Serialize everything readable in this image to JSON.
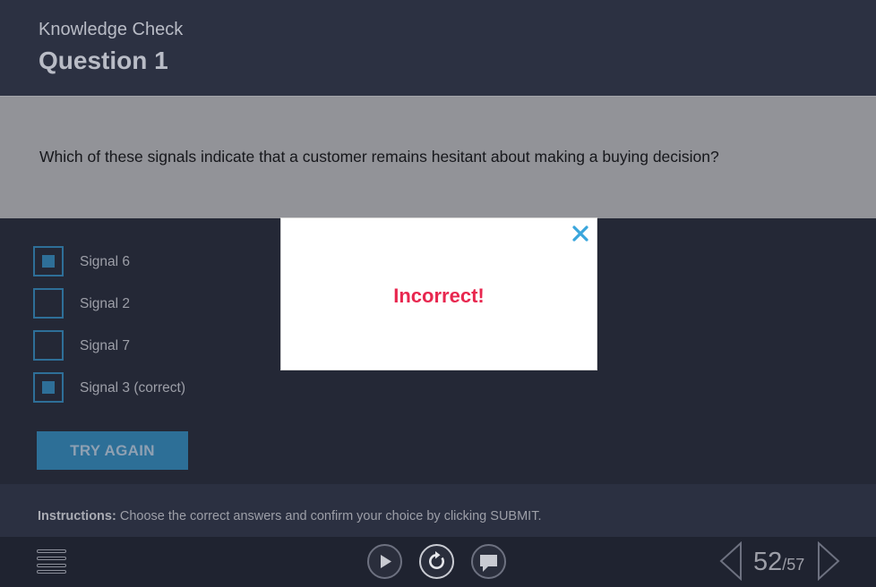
{
  "header": {
    "subtitle": "Knowledge Check",
    "title": "Question 1"
  },
  "question": {
    "text": "Which of these signals indicate that a customer remains hesitant about making a buying decision?"
  },
  "options": [
    {
      "label": "Signal 6",
      "checked": true
    },
    {
      "label": "Signal 2",
      "checked": false
    },
    {
      "label": "Signal 7",
      "checked": false
    },
    {
      "label": "Signal 3 (correct)",
      "checked": true
    }
  ],
  "actions": {
    "try_again_label": "TRY AGAIN"
  },
  "instructions": {
    "prefix": "Instructions:",
    "text": "Choose the correct answers and confirm your choice by clicking SUBMIT."
  },
  "feedback": {
    "message": "Incorrect!",
    "close_icon": "close-icon"
  },
  "footer": {
    "menu_icon": "menu-icon",
    "play_icon": "play-icon",
    "replay_icon": "replay-icon",
    "comment_icon": "comment-icon",
    "current_page": "52",
    "total_pages": "/57"
  },
  "colors": {
    "background": "#242836",
    "header": "#2c3142",
    "question_band": "#929398",
    "accent": "#2d6f97",
    "error": "#e8274f",
    "close_icon": "#3aa6dc"
  }
}
